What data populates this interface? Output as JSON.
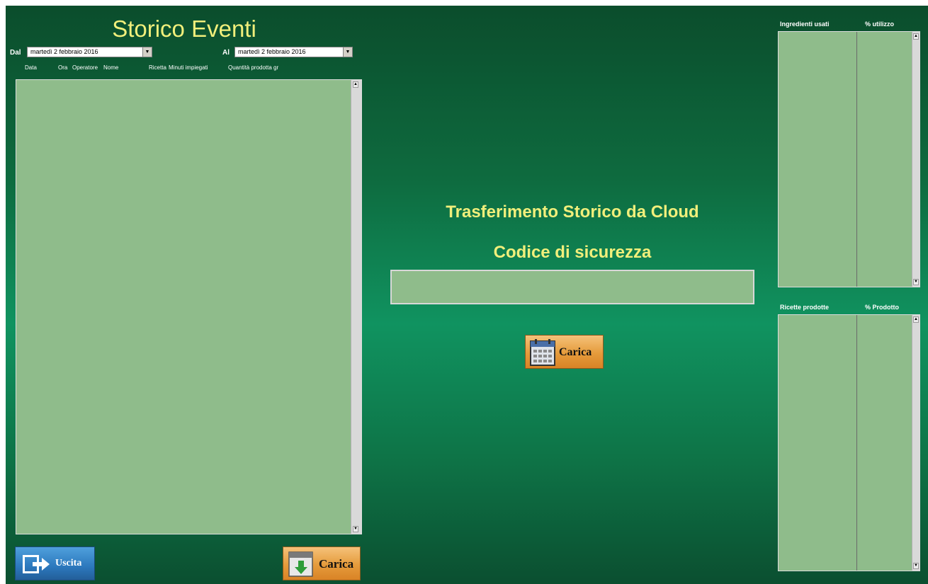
{
  "title": "Storico Eventi",
  "filters": {
    "from_label": "Dal",
    "from_value": "martedì  2 febbraio  2016",
    "to_label": "Al",
    "to_value": "martedì  2 febbraio  2016"
  },
  "columns": [
    "Data",
    "Ora",
    "Operatore",
    "Nome",
    "Ricetta",
    "Minuti impiegati",
    "Quantità prodotta gr"
  ],
  "center": {
    "heading": "Trasferimento Storico da Cloud",
    "code_label": "Codice di sicurezza",
    "code_value": "",
    "load_button": "Carica"
  },
  "bottom": {
    "exit_button": "Uscita",
    "load_button": "Carica"
  },
  "ingredients_panel": {
    "col1": "Ingredienti usati",
    "col2": "% utilizzo"
  },
  "recipes_panel": {
    "col1": "Ricette prodotte",
    "col2": "% Prodotto"
  },
  "colors": {
    "accent_yellow": "#f1ef7b",
    "panel_green": "#8fbc8b",
    "background_green": "#109360"
  },
  "icons": [
    "calendar-icon",
    "exit-arrow-icon",
    "download-calendar-icon",
    "dropdown-arrow-icon",
    "scroll-up-arrow-icon",
    "scroll-down-arrow-icon"
  ]
}
